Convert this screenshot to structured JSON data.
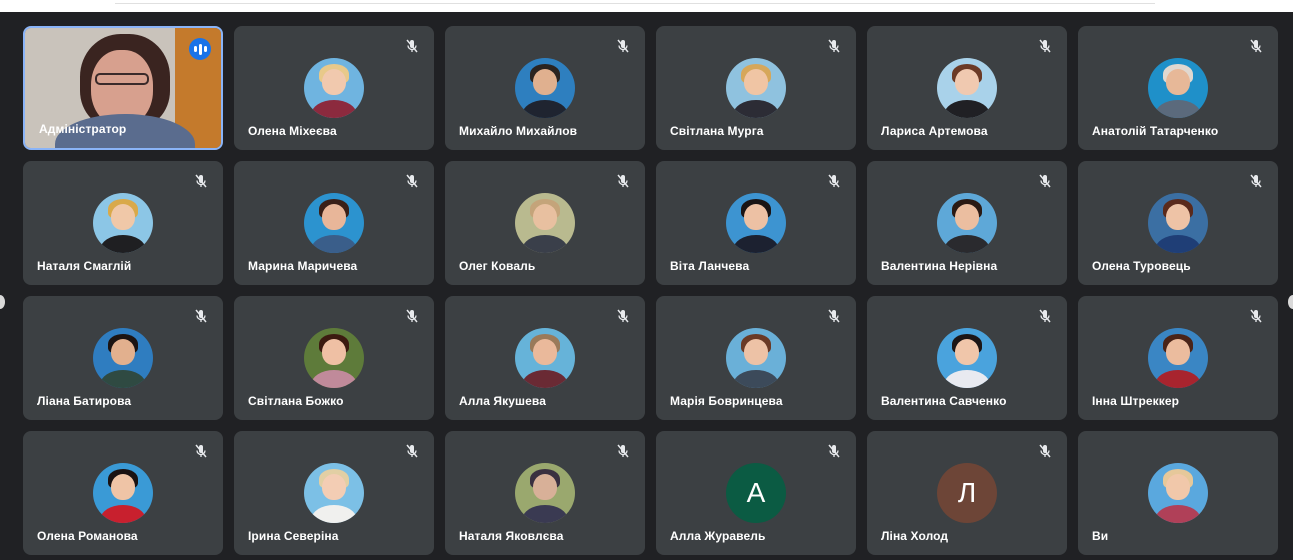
{
  "colors": {
    "background": "#202124",
    "tile": "#3c4043",
    "active_border": "#8ab4f8",
    "speaking": "#1a73e8"
  },
  "participants": [
    {
      "name": "Адміністратор",
      "video": true,
      "speaking": true
    },
    {
      "name": "Олена Міхеєва",
      "muted": true,
      "photo": {
        "bg": "#6fb4e0",
        "hair": "#e8c98a",
        "skin": "#f1c9ae",
        "cloth": "#8c2a3e"
      }
    },
    {
      "name": "Михайло Михайлов",
      "muted": true,
      "photo": {
        "bg": "#2e7fbf",
        "hair": "#2a2320",
        "skin": "#e0b08f",
        "cloth": "#1f2430"
      }
    },
    {
      "name": "Світлана Мурга",
      "muted": true,
      "photo": {
        "bg": "#8fc2df",
        "hair": "#d6a75a",
        "skin": "#f0c5a4",
        "cloth": "#2c2c35"
      }
    },
    {
      "name": "Лариса Артемова",
      "muted": true,
      "photo": {
        "bg": "#a9d2ea",
        "hair": "#6b3a26",
        "skin": "#f0c9b0",
        "cloth": "#202024"
      }
    },
    {
      "name": "Анатолій Татарченко",
      "muted": true,
      "photo": {
        "bg": "#1f90c9",
        "hair": "#e0d8d0",
        "skin": "#e7b898",
        "cloth": "#5b6a7c"
      }
    },
    {
      "name": "Наталя Смаглій",
      "muted": true,
      "photo": {
        "bg": "#8cc6e6",
        "hair": "#d9a94a",
        "skin": "#f0c8a8",
        "cloth": "#1f1f22"
      }
    },
    {
      "name": "Марина Маричева",
      "muted": true,
      "photo": {
        "bg": "#2c93cf",
        "hair": "#3a2018",
        "skin": "#e8b699",
        "cloth": "#3a5e8a"
      }
    },
    {
      "name": "Олег Коваль",
      "muted": true,
      "photo": {
        "bg": "#b9ba8f",
        "hair": "#c4a47a",
        "skin": "#e8c0a0",
        "cloth": "#3a3f4a"
      }
    },
    {
      "name": "Віта Ланчева",
      "muted": true,
      "photo": {
        "bg": "#3d94d1",
        "hair": "#1a1414",
        "skin": "#edc1a4",
        "cloth": "#1c2130"
      }
    },
    {
      "name": "Валентина Нерівна",
      "muted": true,
      "photo": {
        "bg": "#5ea8d8",
        "hair": "#2a1a14",
        "skin": "#ebbea0",
        "cloth": "#2a2a2e"
      }
    },
    {
      "name": "Олена Туровець",
      "muted": true,
      "photo": {
        "bg": "#3b6fa3",
        "hair": "#5a2a1c",
        "skin": "#eec3a6",
        "cloth": "#1f3e76"
      }
    },
    {
      "name": "Ліана Батирова",
      "muted": true,
      "photo": {
        "bg": "#2f7dc0",
        "hair": "#1c1412",
        "skin": "#e2b08e",
        "cloth": "#2f4a42"
      }
    },
    {
      "name": "Світлана Божко",
      "muted": true,
      "photo": {
        "bg": "#5e7b3a",
        "hair": "#3c1a10",
        "skin": "#efc0a4",
        "cloth": "#c08a9a"
      }
    },
    {
      "name": "Алла Якушева",
      "muted": true,
      "photo": {
        "bg": "#66b3d9",
        "hair": "#9a7a5a",
        "skin": "#eab99b",
        "cloth": "#6a2a34"
      }
    },
    {
      "name": "Марія Бовринцева",
      "muted": true,
      "photo": {
        "bg": "#6ab0d8",
        "hair": "#6a3a26",
        "skin": "#edc2a6",
        "cloth": "#3c4a5a"
      }
    },
    {
      "name": "Валентина Савченко",
      "muted": true,
      "photo": {
        "bg": "#4aa3dd",
        "hair": "#1c1616",
        "skin": "#f0c6aa",
        "cloth": "#e8eaf0"
      }
    },
    {
      "name": "Інна Штреккер",
      "muted": true,
      "photo": {
        "bg": "#3a86c4",
        "hair": "#4a2418",
        "skin": "#ebbc9e",
        "cloth": "#a8242e"
      }
    },
    {
      "name": "Олена Романова",
      "muted": true,
      "photo": {
        "bg": "#3a9ad6",
        "hair": "#1a1212",
        "skin": "#efc4a6",
        "cloth": "#c8202e"
      }
    },
    {
      "name": "Ірина Северіна",
      "muted": true,
      "photo": {
        "bg": "#7cc0e6",
        "hair": "#e2cfa4",
        "skin": "#f3cdb4",
        "cloth": "#f0f0ee"
      }
    },
    {
      "name": "Наталя Яковлєва",
      "muted": true,
      "photo": {
        "bg": "#9aa86e",
        "hair": "#3a3040",
        "skin": "#d8b098",
        "cloth": "#3a3a52"
      }
    },
    {
      "name": "Алла Журавель",
      "muted": true,
      "initial": "А",
      "initial_color": "#0b5b43"
    },
    {
      "name": "Ліна Холод",
      "muted": true,
      "initial": "Л",
      "initial_color": "#6d4537"
    },
    {
      "name": "Ви",
      "muted": false,
      "photo": {
        "bg": "#5aa8de",
        "hair": "#e6c89a",
        "skin": "#f1c8aa",
        "cloth": "#b04058"
      }
    }
  ]
}
